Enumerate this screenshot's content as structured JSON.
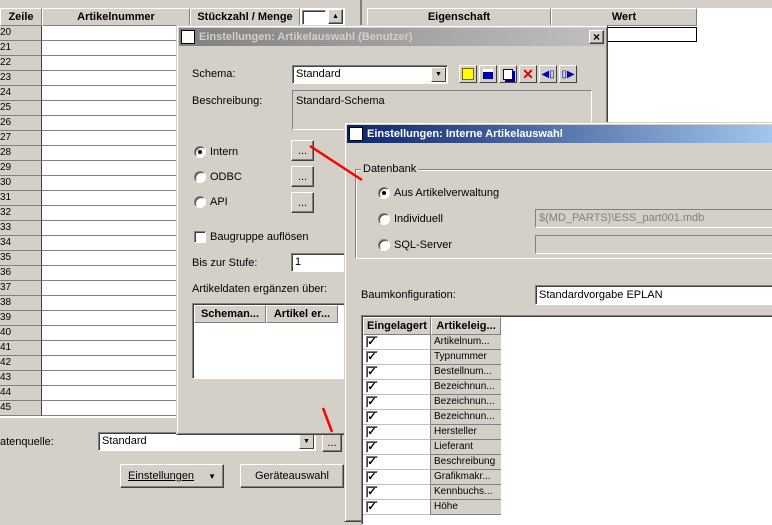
{
  "main_table": {
    "headers": [
      "Zeile",
      "Artikelnummer",
      "Stückzahl / Menge"
    ],
    "rows": [
      "20",
      "21",
      "22",
      "23",
      "24",
      "25",
      "26",
      "27",
      "28",
      "29",
      "30",
      "31",
      "32",
      "33",
      "34",
      "35",
      "36",
      "37",
      "38",
      "39",
      "40",
      "41",
      "42",
      "43",
      "44",
      "45"
    ]
  },
  "bottom": {
    "datenquelle_label": "atenquelle:",
    "datenquelle_value": "Standard",
    "browse": "...",
    "einstellungen_label": "Einstellungen",
    "geraeteauswahl_label": "Geräteauswahl"
  },
  "right_table": {
    "headers": [
      "Eigenschaft",
      "Wert"
    ]
  },
  "dialog1": {
    "title": "Einstellungen: Artikelauswahl (Benutzer)",
    "schema_label": "Schema:",
    "schema_value": "Standard",
    "beschreibung_label": "Beschreibung:",
    "beschreibung_value": "Standard-Schema",
    "radio_intern": "Intern",
    "radio_odbc": "ODBC",
    "radio_api": "API",
    "browse": "...",
    "baugruppe_label": "Baugruppe auflösen",
    "bis_label": "Bis zur Stufe:",
    "bis_value": "1",
    "ergaenzen_label": "Artikeldaten ergänzen über:",
    "list_headers": [
      "Scheman...",
      "Artikel er..."
    ],
    "close": "×"
  },
  "dialog2": {
    "title": "Einstellungen: Interne Artikelauswahl",
    "group_label": "Datenbank",
    "radio_aus": "Aus Artikelverwaltung",
    "radio_indiv": "Individuell",
    "radio_sql": "SQL-Server",
    "indiv_path": "$(MD_PARTS)\\ESS_part001.mdb",
    "baum_label": "Baumkonfiguration:",
    "baum_value": "Standardvorgabe EPLAN",
    "list_headers": [
      "Eingelagert",
      "Artikeleig..."
    ],
    "list_items": [
      "Artikelnum...",
      "Typnummer",
      "Bestellnum...",
      "Bezeichnun...",
      "Bezeichnun...",
      "Bezeichnun...",
      "Hersteller",
      "Lieferant",
      "Beschreibung",
      "Grafikmakr...",
      "Kennbuchs...",
      "Höhe"
    ]
  },
  "colors": {
    "title_active": "#0a246a",
    "title_active_end": "#a6caf0",
    "title_inactive": "#808080",
    "annotation": "#ff0000"
  }
}
